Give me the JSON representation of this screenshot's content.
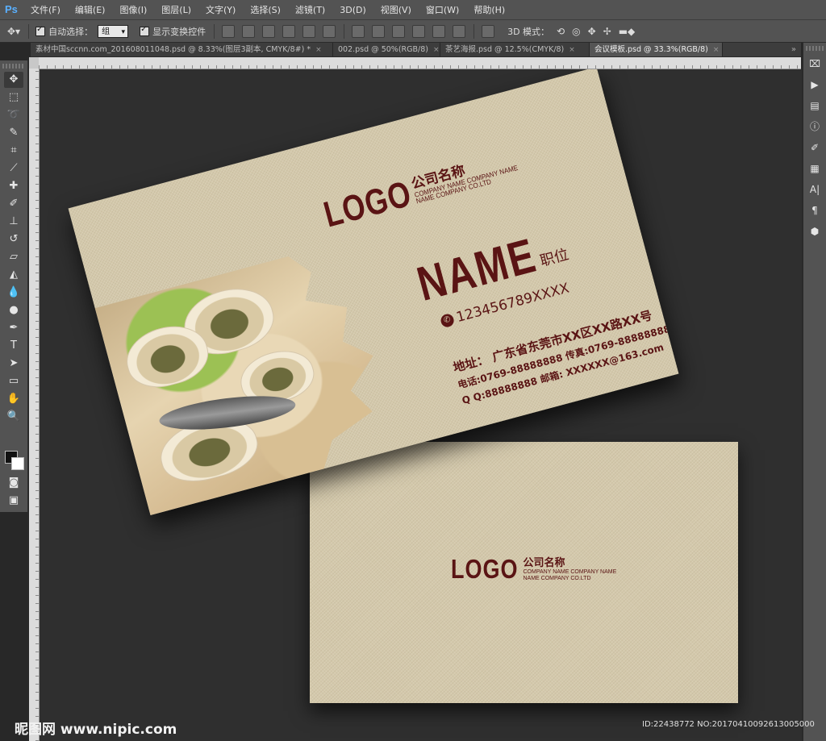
{
  "app": {
    "logo": "Ps"
  },
  "menu": [
    "文件(F)",
    "编辑(E)",
    "图像(I)",
    "图层(L)",
    "文字(Y)",
    "选择(S)",
    "滤镜(T)",
    "3D(D)",
    "视图(V)",
    "窗口(W)",
    "帮助(H)"
  ],
  "options": {
    "auto_select_label": "自动选择：",
    "auto_select_value": "组",
    "show_transform_label": "显示变换控件",
    "mode_3d_label": "3D 模式："
  },
  "tabs": [
    {
      "label": "素材中国sccnn.com_201608011048.psd @ 8.33%(图层3副本, CMYK/8#) *",
      "active": false
    },
    {
      "label": "002.psd @ 50%(RGB/8)",
      "active": false
    },
    {
      "label": "茶艺海报.psd @ 12.5%(CMYK/8)",
      "active": false
    },
    {
      "label": "会议模板.psd @ 33.3%(RGB/8)",
      "active": true
    }
  ],
  "tabs_overflow": "»",
  "tools": [
    "move-tool",
    "marquee-tool",
    "lasso-tool",
    "quick-select-tool",
    "crop-tool",
    "eyedropper-tool",
    "healing-tool",
    "brush-tool",
    "stamp-tool",
    "history-brush-tool",
    "eraser-tool",
    "gradient-tool",
    "blur-tool",
    "dodge-tool",
    "pen-tool",
    "type-tool",
    "path-select-tool",
    "shape-tool",
    "hand-tool",
    "zoom-tool"
  ],
  "colors": {
    "foreground": "#111111",
    "background": "#ffffff",
    "maroon": "#5a1414",
    "card": "#d4c9ac"
  },
  "front_card": {
    "logo": "LOGO",
    "company_cn": "公司名称",
    "company_en_1": "COMPANY NAME COMPANY NAME",
    "company_en_2": "NAME COMPANY CO.LTD",
    "name": "NAME",
    "title": "职位",
    "phone": "123456789XXXX",
    "address": "地址：  广东省东莞市XX区XX路XX号",
    "tel_line": "电话:0769-88888888  传真:0769-88888888",
    "qq_line": "Q Q:88888888    邮箱: XXXXXX@163.com"
  },
  "back_card": {
    "logo": "LOGO",
    "company_cn": "公司名称",
    "company_en_1": "COMPANY NAME COMPANY NAME",
    "company_en_2": "NAME COMPANY CO.LTD"
  },
  "watermark": {
    "left": "昵图网 www.nipic.com",
    "right": "ID:22438772 NO:20170410092613005000"
  }
}
